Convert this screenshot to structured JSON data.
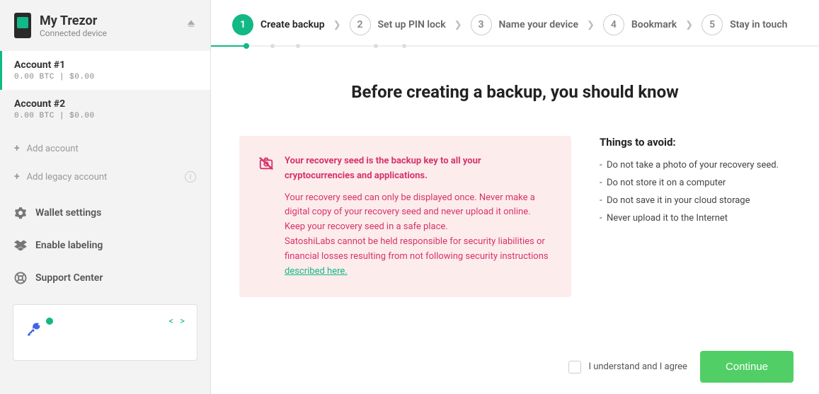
{
  "device": {
    "name": "My Trezor",
    "status": "Connected device"
  },
  "accounts": [
    {
      "name": "Account #1",
      "balance": "0.00 BTC | $0.00"
    },
    {
      "name": "Account #2",
      "balance": "0.00 BTC | $0.00"
    }
  ],
  "sidebar": {
    "add_account": "Add account",
    "add_legacy": "Add legacy account",
    "wallet_settings": "Wallet settings",
    "enable_labeling": "Enable labeling",
    "support_center": "Support Center"
  },
  "steps": [
    {
      "num": "1",
      "label": "Create backup"
    },
    {
      "num": "2",
      "label": "Set up PIN lock"
    },
    {
      "num": "3",
      "label": "Name your device"
    },
    {
      "num": "4",
      "label": "Bookmark"
    },
    {
      "num": "5",
      "label": "Stay in touch"
    }
  ],
  "content": {
    "title": "Before creating a backup, you should know",
    "warning_bold": "Your recovery seed is the backup key to all your cryptocurrencies and applications.",
    "warning_text1": "Your recovery seed can only be displayed once. Never make a digital copy of your recovery seed and never upload it online. Keep your recovery seed in a safe place.",
    "warning_text2": "SatoshiLabs cannot be held responsible for security liabilities or financial losses resulting from not following security instructions ",
    "warning_link": "described here.",
    "avoid_title": "Things to avoid:",
    "avoid_items": [
      "Do not take a photo of your recovery seed.",
      "Do not store it on a computer",
      "Do not save it in your cloud storage",
      "Never upload it to the Internet"
    ]
  },
  "footer": {
    "checkbox_label": "I understand and I agree",
    "continue": "Continue"
  }
}
